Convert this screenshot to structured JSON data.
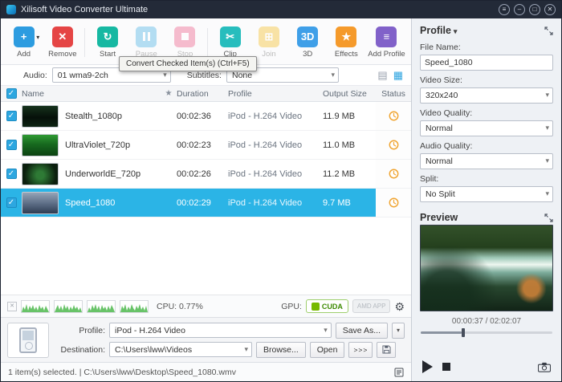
{
  "window": {
    "title": "Xilisoft Video Converter Ultimate"
  },
  "toolbar": {
    "tooltip": "Convert Checked Item(s) (Ctrl+F5)",
    "items": [
      {
        "label": "Add",
        "glyph": "+",
        "icon": "add-icon",
        "disabled": false
      },
      {
        "label": "Remove",
        "glyph": "✕",
        "icon": "remove-icon",
        "disabled": false
      },
      {
        "label": "Start",
        "glyph": "↻",
        "icon": "convert-icon",
        "disabled": false
      },
      {
        "label": "Pause",
        "icon": "pause-icon",
        "disabled": true
      },
      {
        "label": "Stop",
        "icon": "stop-icon",
        "disabled": true
      },
      {
        "label": "Clip",
        "glyph": "✂",
        "icon": "clip-icon",
        "disabled": false
      },
      {
        "label": "Join",
        "glyph": "⊞",
        "icon": "join-icon",
        "disabled": true
      },
      {
        "label": "3D",
        "glyph": "3D",
        "icon": "3d-icon",
        "disabled": false
      },
      {
        "label": "Effects",
        "glyph": "★",
        "icon": "effects-icon",
        "disabled": false
      },
      {
        "label": "Add Profile",
        "glyph": "≡",
        "icon": "add-profile-icon",
        "disabled": false
      }
    ]
  },
  "filterbar": {
    "audio_label": "Audio:",
    "audio_value": "01 wma9-2ch",
    "subtitles_label": "Subtitles:",
    "subtitles_value": "None"
  },
  "table": {
    "headers": {
      "name": "Name",
      "star": "★",
      "duration": "Duration",
      "profile": "Profile",
      "output_size": "Output Size",
      "status": "Status"
    },
    "rows": [
      {
        "name": "Stealth_1080p",
        "duration": "00:02:36",
        "profile": "iPod - H.264 Video",
        "output_size": "11.9 MB",
        "checked": true,
        "selected": false,
        "status": "waiting"
      },
      {
        "name": "UltraViolet_720p",
        "duration": "00:02:23",
        "profile": "iPod - H.264 Video",
        "output_size": "11.0 MB",
        "checked": true,
        "selected": false,
        "status": "waiting"
      },
      {
        "name": "UnderworldE_720p",
        "duration": "00:02:26",
        "profile": "iPod - H.264 Video",
        "output_size": "11.2 MB",
        "checked": true,
        "selected": false,
        "status": "waiting"
      },
      {
        "name": "Speed_1080",
        "duration": "00:02:29",
        "profile": "iPod - H.264 Video",
        "output_size": "9.7 MB",
        "checked": true,
        "selected": true,
        "status": "waiting"
      }
    ]
  },
  "monitor": {
    "cpu_text": "CPU: 0.77%",
    "gpu_label": "GPU:",
    "cuda_label": "CUDA",
    "amd_label": "AMD APP"
  },
  "output": {
    "profile_label": "Profile:",
    "profile_value": "iPod - H.264 Video",
    "save_as": "Save As...",
    "destination_label": "Destination:",
    "destination_value": "C:\\Users\\lww\\Videos",
    "browse": "Browse...",
    "open": "Open",
    "more": ">>>"
  },
  "statusbar": {
    "text": "1 item(s) selected. | C:\\Users\\lww\\Desktop\\Speed_1080.wmv"
  },
  "sidebar": {
    "profile_title": "Profile",
    "file_name_label": "File Name:",
    "file_name_value": "Speed_1080",
    "video_size_label": "Video Size:",
    "video_size_value": "320x240",
    "video_quality_label": "Video Quality:",
    "video_quality_value": "Normal",
    "audio_quality_label": "Audio Quality:",
    "audio_quality_value": "Normal",
    "split_label": "Split:",
    "split_value": "No Split",
    "preview_title": "Preview",
    "time": "00:00:37 / 02:02:07"
  },
  "colors": {
    "accent": "#2bb4e6",
    "selected_row": "#2bb4e6",
    "titlebar": "#232a38",
    "cuda_green": "#76b900",
    "status_clock": "#f0a532"
  }
}
